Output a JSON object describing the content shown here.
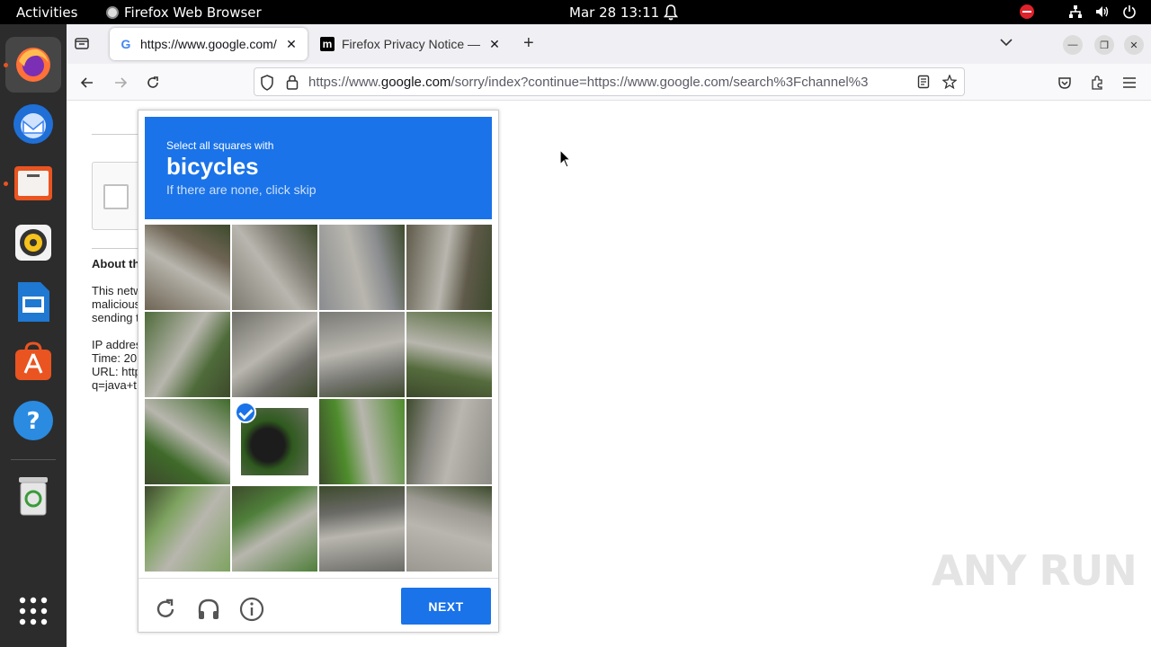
{
  "topbar": {
    "activities": "Activities",
    "app_name": "Firefox Web Browser",
    "clock": "Mar 28  13:11"
  },
  "dock": {
    "items": [
      "firefox-icon",
      "thunderbird-icon",
      "files-icon",
      "rhythmbox-icon",
      "libreoffice-impress-icon",
      "app-center-icon",
      "help-icon",
      "trash-icon",
      "show-apps-icon"
    ]
  },
  "browser": {
    "tabs": [
      {
        "label": "https://www.google.com/",
        "active": true,
        "icon": "google-favicon"
      },
      {
        "label": "Firefox Privacy Notice — ",
        "active": false,
        "icon": "mozilla-favicon"
      }
    ],
    "url": {
      "prefix": "https://www.",
      "domain": "google.com",
      "path": "/sorry/index?continue=https://www.google.com/search%3Fchannel%3"
    }
  },
  "page": {
    "about_heading": "About th",
    "lines": [
      "This netw",
      "malicious",
      "sending t"
    ],
    "ip_lines": [
      "IP addres",
      "Time: 20",
      "URL: http",
      "q=java+t"
    ]
  },
  "captcha": {
    "instruction": "Select all squares with",
    "target": "bicycles",
    "skip_hint": "If there are none, click skip",
    "next_label": "NEXT",
    "grid_size": 4,
    "selected_tiles": [
      9
    ],
    "colors": {
      "accent": "#1a73e8"
    }
  },
  "watermark": "ANY RUN"
}
